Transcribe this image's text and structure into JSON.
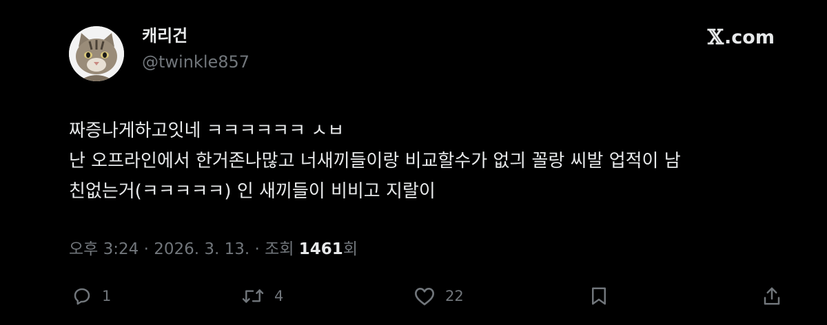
{
  "author": {
    "display_name": "캐리건",
    "handle": "@twinkle857",
    "avatar_icon": "cat-photo-icon"
  },
  "brand": {
    "symbol": "𝕏",
    "text": ".com"
  },
  "tweet": {
    "lines": [
      "짜증나게하고잇네 ㅋㅋㅋㅋㅋㅋ ㅅㅂ",
      "난 오프라인에서 한거존나많고 너새끼들이랑 비교할수가 없긔 꼴랑 씨발 업적이 남",
      "친없는거(ㅋㅋㅋㅋㅋ) 인 새끼들이 비비고 지랄이"
    ]
  },
  "meta": {
    "time": "오후 3:24",
    "sep1": " · ",
    "date": "2026. 3. 13.",
    "sep2": " · ",
    "views_label": "조회 ",
    "views_count": "1461",
    "views_suffix": "회"
  },
  "actions": {
    "reply": {
      "icon": "reply-icon",
      "count": "1"
    },
    "retweet": {
      "icon": "retweet-icon",
      "count": "4"
    },
    "like": {
      "icon": "heart-icon",
      "count": "22"
    },
    "bookmark": {
      "icon": "bookmark-icon"
    },
    "share": {
      "icon": "share-icon"
    }
  },
  "colors": {
    "background": "#000000",
    "primary_text": "#e7e9ea",
    "secondary_text": "#71767b"
  }
}
